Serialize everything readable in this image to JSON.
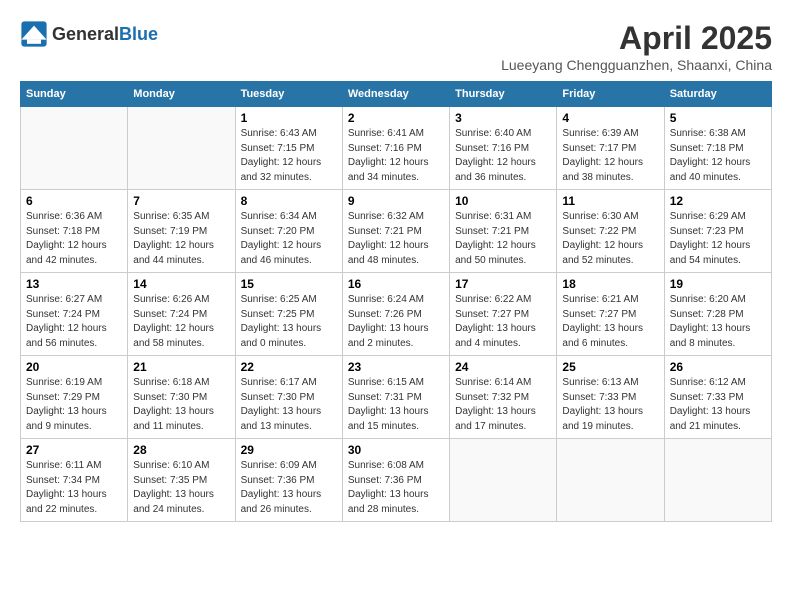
{
  "logo": {
    "general": "General",
    "blue": "Blue"
  },
  "title": "April 2025",
  "location": "Lueeyang Chengguanzhen, Shaanxi, China",
  "days_of_week": [
    "Sunday",
    "Monday",
    "Tuesday",
    "Wednesday",
    "Thursday",
    "Friday",
    "Saturday"
  ],
  "weeks": [
    [
      {
        "day": "",
        "info": ""
      },
      {
        "day": "",
        "info": ""
      },
      {
        "day": "1",
        "info": "Sunrise: 6:43 AM\nSunset: 7:15 PM\nDaylight: 12 hours\nand 32 minutes."
      },
      {
        "day": "2",
        "info": "Sunrise: 6:41 AM\nSunset: 7:16 PM\nDaylight: 12 hours\nand 34 minutes."
      },
      {
        "day": "3",
        "info": "Sunrise: 6:40 AM\nSunset: 7:16 PM\nDaylight: 12 hours\nand 36 minutes."
      },
      {
        "day": "4",
        "info": "Sunrise: 6:39 AM\nSunset: 7:17 PM\nDaylight: 12 hours\nand 38 minutes."
      },
      {
        "day": "5",
        "info": "Sunrise: 6:38 AM\nSunset: 7:18 PM\nDaylight: 12 hours\nand 40 minutes."
      }
    ],
    [
      {
        "day": "6",
        "info": "Sunrise: 6:36 AM\nSunset: 7:18 PM\nDaylight: 12 hours\nand 42 minutes."
      },
      {
        "day": "7",
        "info": "Sunrise: 6:35 AM\nSunset: 7:19 PM\nDaylight: 12 hours\nand 44 minutes."
      },
      {
        "day": "8",
        "info": "Sunrise: 6:34 AM\nSunset: 7:20 PM\nDaylight: 12 hours\nand 46 minutes."
      },
      {
        "day": "9",
        "info": "Sunrise: 6:32 AM\nSunset: 7:21 PM\nDaylight: 12 hours\nand 48 minutes."
      },
      {
        "day": "10",
        "info": "Sunrise: 6:31 AM\nSunset: 7:21 PM\nDaylight: 12 hours\nand 50 minutes."
      },
      {
        "day": "11",
        "info": "Sunrise: 6:30 AM\nSunset: 7:22 PM\nDaylight: 12 hours\nand 52 minutes."
      },
      {
        "day": "12",
        "info": "Sunrise: 6:29 AM\nSunset: 7:23 PM\nDaylight: 12 hours\nand 54 minutes."
      }
    ],
    [
      {
        "day": "13",
        "info": "Sunrise: 6:27 AM\nSunset: 7:24 PM\nDaylight: 12 hours\nand 56 minutes."
      },
      {
        "day": "14",
        "info": "Sunrise: 6:26 AM\nSunset: 7:24 PM\nDaylight: 12 hours\nand 58 minutes."
      },
      {
        "day": "15",
        "info": "Sunrise: 6:25 AM\nSunset: 7:25 PM\nDaylight: 13 hours\nand 0 minutes."
      },
      {
        "day": "16",
        "info": "Sunrise: 6:24 AM\nSunset: 7:26 PM\nDaylight: 13 hours\nand 2 minutes."
      },
      {
        "day": "17",
        "info": "Sunrise: 6:22 AM\nSunset: 7:27 PM\nDaylight: 13 hours\nand 4 minutes."
      },
      {
        "day": "18",
        "info": "Sunrise: 6:21 AM\nSunset: 7:27 PM\nDaylight: 13 hours\nand 6 minutes."
      },
      {
        "day": "19",
        "info": "Sunrise: 6:20 AM\nSunset: 7:28 PM\nDaylight: 13 hours\nand 8 minutes."
      }
    ],
    [
      {
        "day": "20",
        "info": "Sunrise: 6:19 AM\nSunset: 7:29 PM\nDaylight: 13 hours\nand 9 minutes."
      },
      {
        "day": "21",
        "info": "Sunrise: 6:18 AM\nSunset: 7:30 PM\nDaylight: 13 hours\nand 11 minutes."
      },
      {
        "day": "22",
        "info": "Sunrise: 6:17 AM\nSunset: 7:30 PM\nDaylight: 13 hours\nand 13 minutes."
      },
      {
        "day": "23",
        "info": "Sunrise: 6:15 AM\nSunset: 7:31 PM\nDaylight: 13 hours\nand 15 minutes."
      },
      {
        "day": "24",
        "info": "Sunrise: 6:14 AM\nSunset: 7:32 PM\nDaylight: 13 hours\nand 17 minutes."
      },
      {
        "day": "25",
        "info": "Sunrise: 6:13 AM\nSunset: 7:33 PM\nDaylight: 13 hours\nand 19 minutes."
      },
      {
        "day": "26",
        "info": "Sunrise: 6:12 AM\nSunset: 7:33 PM\nDaylight: 13 hours\nand 21 minutes."
      }
    ],
    [
      {
        "day": "27",
        "info": "Sunrise: 6:11 AM\nSunset: 7:34 PM\nDaylight: 13 hours\nand 22 minutes."
      },
      {
        "day": "28",
        "info": "Sunrise: 6:10 AM\nSunset: 7:35 PM\nDaylight: 13 hours\nand 24 minutes."
      },
      {
        "day": "29",
        "info": "Sunrise: 6:09 AM\nSunset: 7:36 PM\nDaylight: 13 hours\nand 26 minutes."
      },
      {
        "day": "30",
        "info": "Sunrise: 6:08 AM\nSunset: 7:36 PM\nDaylight: 13 hours\nand 28 minutes."
      },
      {
        "day": "",
        "info": ""
      },
      {
        "day": "",
        "info": ""
      },
      {
        "day": "",
        "info": ""
      }
    ]
  ]
}
